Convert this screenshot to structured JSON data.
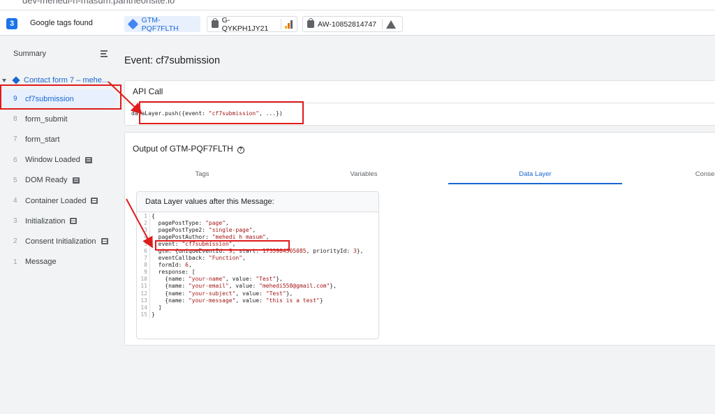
{
  "url_strip": {
    "text": "dev-mehedi-h-masum.pantheonsite.io"
  },
  "topbar": {
    "count": "3",
    "label": "Google tags found",
    "tags": [
      {
        "id": "GTM-PQF7FLTH",
        "icon": "gtm-icon",
        "active": true
      },
      {
        "id": "G-QYKPH1JY21",
        "icon": "analytics-icon",
        "active": false
      },
      {
        "id": "AW-10852814747",
        "icon": "google-ads-icon",
        "active": false
      }
    ]
  },
  "sidebar": {
    "summary": "Summary",
    "container": "Contact form 7 – mehe...",
    "events": [
      {
        "num": "9",
        "label": "cf7submission",
        "selected": true,
        "has_icon": false
      },
      {
        "num": "8",
        "label": "form_submit",
        "has_icon": false
      },
      {
        "num": "7",
        "label": "form_start",
        "has_icon": false
      },
      {
        "num": "6",
        "label": "Window Loaded",
        "has_icon": true
      },
      {
        "num": "5",
        "label": "DOM Ready",
        "has_icon": true
      },
      {
        "num": "4",
        "label": "Container Loaded",
        "has_icon": true
      },
      {
        "num": "3",
        "label": "Initialization",
        "has_icon": true
      },
      {
        "num": "2",
        "label": "Consent Initialization",
        "has_icon": true
      },
      {
        "num": "1",
        "label": "Message",
        "has_icon": false
      }
    ]
  },
  "main": {
    "event_title": "Event: cf7submission",
    "api_call": {
      "title": "API Call",
      "code_prefix": "dataLayer.push({event: ",
      "code_string": "\"cf7submission\"",
      "code_suffix": ", ...})"
    },
    "output": {
      "title": "Output of GTM-PQF7FLTH",
      "tabs": [
        "Tags",
        "Variables",
        "Data Layer",
        "Consent"
      ],
      "active_tab": "Data Layer",
      "data_layer_header": "Data Layer values after this Message:",
      "lines": [
        {
          "n": "1",
          "segs": [
            [
              "{",
              "p"
            ]
          ]
        },
        {
          "n": "2",
          "segs": [
            [
              "  pagePostType: ",
              "p"
            ],
            [
              "\"page\"",
              "s"
            ],
            [
              ",",
              "p"
            ]
          ]
        },
        {
          "n": "3",
          "segs": [
            [
              "  pagePostType2: ",
              "p"
            ],
            [
              "\"single-page\"",
              "s"
            ],
            [
              ",",
              "p"
            ]
          ]
        },
        {
          "n": "4",
          "segs": [
            [
              "  pagePostAuthor: ",
              "p"
            ],
            [
              "\"mehedi h masum\"",
              "s"
            ],
            [
              ",",
              "p"
            ]
          ]
        },
        {
          "n": "5",
          "segs": [
            [
              "  event: ",
              "p"
            ],
            [
              "\"cf7submission\"",
              "s"
            ],
            [
              ",",
              "p"
            ]
          ]
        },
        {
          "n": "6",
          "segs": [
            [
              "  gtm: {uniqueEventId: ",
              "p"
            ],
            [
              "9",
              "s"
            ],
            [
              ", start: ",
              "p"
            ],
            [
              "1733984305085",
              "s"
            ],
            [
              ", priorityId: ",
              "p"
            ],
            [
              "3",
              "s"
            ],
            [
              "},",
              "p"
            ]
          ]
        },
        {
          "n": "7",
          "segs": [
            [
              "  eventCallback: ",
              "p"
            ],
            [
              "\"Function\"",
              "s"
            ],
            [
              ",",
              "p"
            ]
          ]
        },
        {
          "n": "8",
          "segs": [
            [
              "  formId: ",
              "p"
            ],
            [
              "6",
              "s"
            ],
            [
              ",",
              "p"
            ]
          ]
        },
        {
          "n": "9",
          "segs": [
            [
              "  response: [",
              "p"
            ]
          ]
        },
        {
          "n": "10",
          "segs": [
            [
              "    {name: ",
              "p"
            ],
            [
              "\"your-name\"",
              "s"
            ],
            [
              ", value: ",
              "p"
            ],
            [
              "\"Test\"",
              "s"
            ],
            [
              "},",
              "p"
            ]
          ]
        },
        {
          "n": "11",
          "segs": [
            [
              "    {name: ",
              "p"
            ],
            [
              "\"your-email\"",
              "s"
            ],
            [
              ", value: ",
              "p"
            ],
            [
              "\"mehedi558@gmail.com\"",
              "s"
            ],
            [
              "},",
              "p"
            ]
          ]
        },
        {
          "n": "12",
          "segs": [
            [
              "    {name: ",
              "p"
            ],
            [
              "\"your-subject\"",
              "s"
            ],
            [
              ", value: ",
              "p"
            ],
            [
              "\"Test\"",
              "s"
            ],
            [
              "},",
              "p"
            ]
          ]
        },
        {
          "n": "13",
          "segs": [
            [
              "    {name: ",
              "p"
            ],
            [
              "\"your-message\"",
              "s"
            ],
            [
              ", value: ",
              "p"
            ],
            [
              "\"this is a test\"",
              "s"
            ],
            [
              "}",
              "p"
            ]
          ]
        },
        {
          "n": "14",
          "segs": [
            [
              "  ]",
              "p"
            ]
          ]
        },
        {
          "n": "15",
          "segs": [
            [
              "}",
              "p"
            ]
          ]
        }
      ]
    }
  },
  "colors": {
    "accent": "#1a73e8",
    "annotation": "#e01b1b",
    "string": "#a31515"
  }
}
